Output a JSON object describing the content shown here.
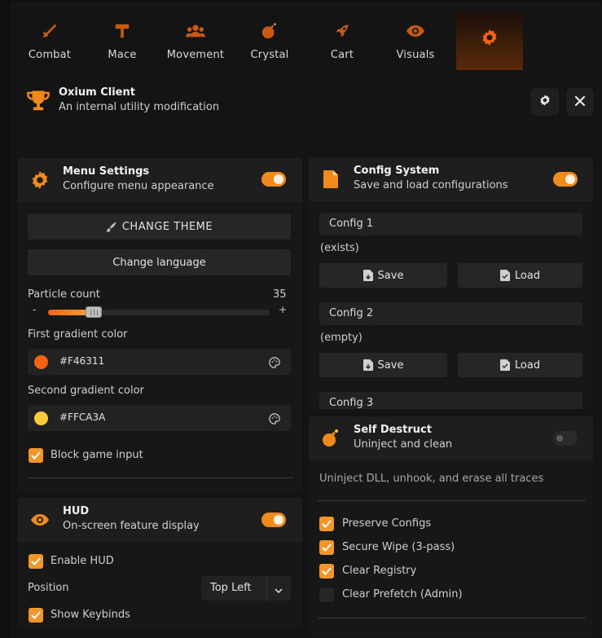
{
  "tabs": [
    {
      "label": "Combat",
      "icon": "sword-icon"
    },
    {
      "label": "Mace",
      "icon": "mace-icon"
    },
    {
      "label": "Movement",
      "icon": "users-icon"
    },
    {
      "label": "Crystal",
      "icon": "bomb-icon"
    },
    {
      "label": "Cart",
      "icon": "rocket-icon"
    },
    {
      "label": "Visuals",
      "icon": "eye-icon"
    },
    {
      "label": "",
      "icon": "gear-icon",
      "active": true
    }
  ],
  "header": {
    "title": "Oxium Client",
    "subtitle": "An internal utility modification"
  },
  "colors": {
    "accent": "#f08a1c",
    "gradient1": "#F46311",
    "gradient2": "#FFCA3A"
  },
  "menu_settings": {
    "title": "Menu Settings",
    "subtitle": "Configure menu appearance",
    "enabled": true,
    "change_theme": "CHANGE THEME",
    "change_language": "Change language",
    "particle_label": "Particle count",
    "particle_value": "35",
    "particle_minus": "-",
    "particle_plus": "+",
    "particle_fraction": 0.17,
    "gradient1_label": "First gradient color",
    "gradient1_value": "#F46311",
    "gradient2_label": "Second gradient color",
    "gradient2_value": "#FFCA3A",
    "block_input": "Block game input",
    "block_input_checked": true
  },
  "hud": {
    "title": "HUD",
    "subtitle": "On-screen feature display",
    "enabled": true,
    "enable_hud": "Enable HUD",
    "position_label": "Position",
    "position_value": "Top Left",
    "show_keybinds": "Show Keybinds"
  },
  "config": {
    "title": "Config System",
    "subtitle": "Save and load configurations",
    "enabled": true,
    "save": "Save",
    "load": "Load",
    "slots": [
      {
        "name": "Config 1",
        "status": "(exists)"
      },
      {
        "name": "Config 2",
        "status": "(empty)"
      },
      {
        "name": "Config 3",
        "status": ""
      }
    ]
  },
  "self_destruct": {
    "title": "Self Destruct",
    "subtitle": "Uninject and clean",
    "enabled": false,
    "description": "Uninject DLL, unhook, and erase all traces",
    "options": [
      {
        "label": "Preserve Configs",
        "checked": true
      },
      {
        "label": "Secure Wipe (3-pass)",
        "checked": true
      },
      {
        "label": "Clear Registry",
        "checked": true
      },
      {
        "label": "Clear Prefetch (Admin)",
        "checked": false
      }
    ]
  }
}
